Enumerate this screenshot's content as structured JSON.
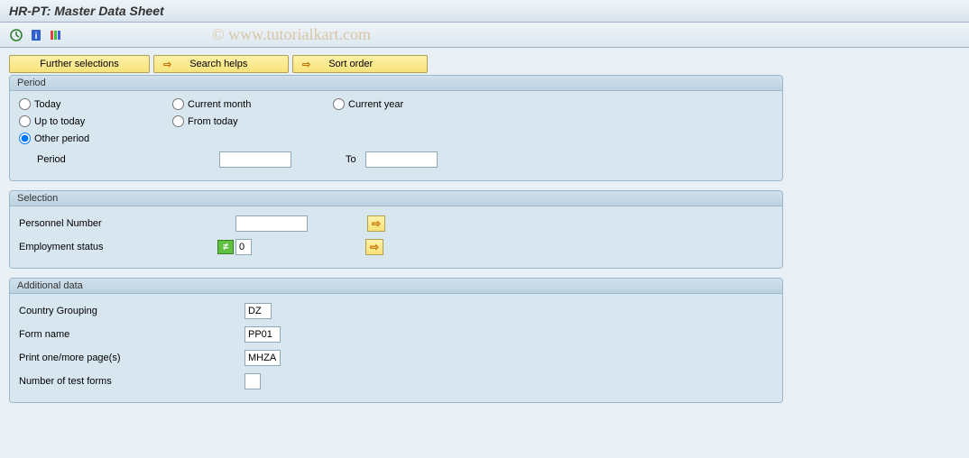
{
  "title": "HR-PT: Master Data Sheet",
  "watermark": "© www.tutorialkart.com",
  "actions": {
    "further_selections": "Further selections",
    "search_helps": "Search helps",
    "sort_order": "Sort order"
  },
  "period": {
    "header": "Period",
    "today": "Today",
    "current_month": "Current month",
    "current_year": "Current year",
    "up_to_today": "Up to today",
    "from_today": "From today",
    "other_period": "Other period",
    "period_label": "Period",
    "to_label": "To",
    "period_from": "",
    "period_to": ""
  },
  "selection": {
    "header": "Selection",
    "personnel_number_label": "Personnel Number",
    "personnel_number_value": "",
    "employment_status_label": "Employment status",
    "employment_status_value": "0"
  },
  "additional": {
    "header": "Additional data",
    "country_grouping_label": "Country Grouping",
    "country_grouping_value": "DZ",
    "form_name_label": "Form name",
    "form_name_value": "PP01",
    "print_pages_label": "Print one/more page(s)",
    "print_pages_value": "MHZA",
    "num_test_forms_label": "Number of test forms",
    "num_test_forms_value": ""
  }
}
